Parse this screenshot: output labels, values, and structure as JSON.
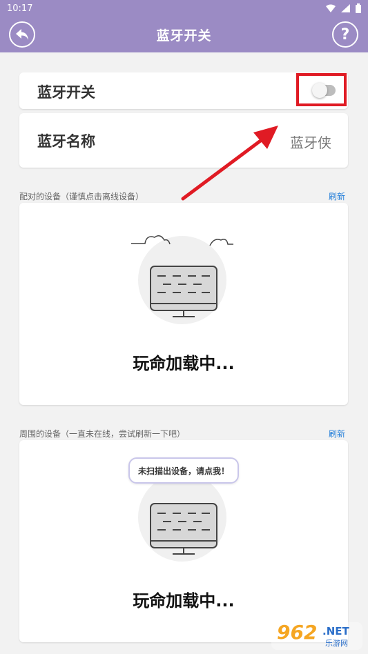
{
  "status_bar": {
    "time": "10:17",
    "icons": [
      "wifi-icon",
      "signal-icon",
      "battery-icon"
    ]
  },
  "app_bar": {
    "title": "蓝牙开关",
    "back_icon": "back-arrow-icon",
    "help_label": "?"
  },
  "bluetooth_switch": {
    "label": "蓝牙开关",
    "enabled": false
  },
  "bluetooth_name": {
    "label": "蓝牙名称",
    "value": "蓝牙侠"
  },
  "paired_devices": {
    "header": "配对的设备（谨慎点击离线设备）",
    "refresh_label": "刷新",
    "loading_text": "玩命加载中..."
  },
  "nearby_devices": {
    "header": "周围的设备（一直未在线，尝试刷新一下吧）",
    "refresh_label": "刷新",
    "hint_bubble": "未扫描出设备，请点我！",
    "loading_text": "玩命加载中..."
  },
  "watermark": {
    "brand": "962",
    "net": ".NET",
    "site_name": "乐游网"
  },
  "colors": {
    "app_bar": "#9b8bc4",
    "highlight": "#e01b24",
    "link": "#1e7bd8"
  }
}
